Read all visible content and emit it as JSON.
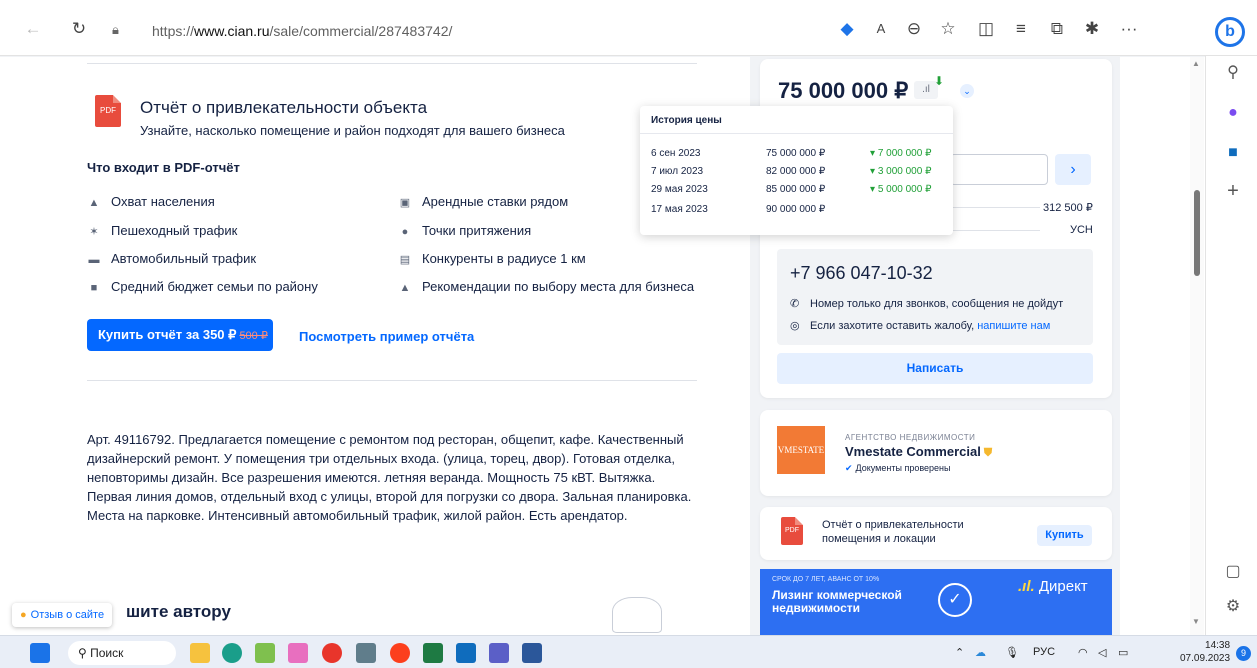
{
  "browser": {
    "url_prefix": "https://",
    "url_domain": "www.cian.ru",
    "url_path": "/sale/commercial/287483742/",
    "edge_copilot": "b",
    "more": "···"
  },
  "report": {
    "pdf_label": "PDF",
    "title": "Отчёт о привлекательности объекта",
    "subtitle": "Узнайте, насколько помещение и район подходят для вашего бизнеса",
    "includes_heading": "Что входит в PDF-отчёт",
    "features_left": [
      "Охват населения",
      "Пешеходный трафик",
      "Автомобильный трафик",
      "Средний бюджет семьи по району"
    ],
    "features_right": [
      "Арендные ставки рядом",
      "Точки притяжения",
      "Конкуренты в радиусе 1 км",
      "Рекомендации по выбору места для бизнеса"
    ],
    "buy_label": "Купить отчёт за 350 ₽",
    "buy_old_price": "500 ₽",
    "example_link": "Посмотреть пример отчёта"
  },
  "description": "Арт. 49116792. Предлагается помещение с ремонтом под ресторан, общепит, кафе. Качественный дизайнерский ремонт. У помещения три отдельных входа. (улица, торец, двор). Готовая отделка, неповторимы дизайн. Все разрешения имеются. летняя веранда. Мощность 75 кВТ. Вытяжка. Первая линия домов, отдельный вход с улицы, второй для погрузки со двора. Зальная планировка. Места на парковке. Интенсивный автомобильный трафик, жилой район. Есть арендатор.",
  "feedback": {
    "label": "Отзыв о сайте",
    "write_author": "шите автору"
  },
  "offer": {
    "price": "75 000 000 ₽",
    "price_per_m": "312 500 ₽",
    "tax": "УСН",
    "phone": "+7 966 047-10-32",
    "note_calls": "Номер только для звонков, сообщения не дойдут",
    "note_complaint": "Если захотите оставить жалобу,",
    "note_complaint_link": "напишите нам",
    "write_button": "Написать"
  },
  "price_history": {
    "title": "История цены",
    "rows": [
      {
        "date": "6 сен 2023",
        "price": "75 000 000 ₽",
        "change": "7 000 000 ₽"
      },
      {
        "date": "7 июл 2023",
        "price": "82 000 000 ₽",
        "change": "3 000 000 ₽"
      },
      {
        "date": "29 мая 2023",
        "price": "85 000 000 ₽",
        "change": "5 000 000 ₽"
      },
      {
        "date": "17 мая 2023",
        "price": "90 000 000 ₽",
        "change": ""
      }
    ]
  },
  "agency": {
    "logo_text": "VMESTATE",
    "type": "АГЕНТСТВО НЕДВИЖИМОСТИ",
    "name": "Vmestate Commercial",
    "verified": "Документы проверены"
  },
  "mini_report": {
    "title": "Отчёт о привлекательности помещения и локации",
    "buy": "Купить"
  },
  "ad": {
    "small": "СРОК ДО 7 ЛЕТ, АВАНС ОТ 10%",
    "big": "Лизинг коммерческой недвижимости",
    "brand": "Директ"
  },
  "taskbar": {
    "search": "Поиск",
    "lang": "РУС",
    "time": "14:38",
    "date": "07.09.2023",
    "notifications": "9"
  }
}
